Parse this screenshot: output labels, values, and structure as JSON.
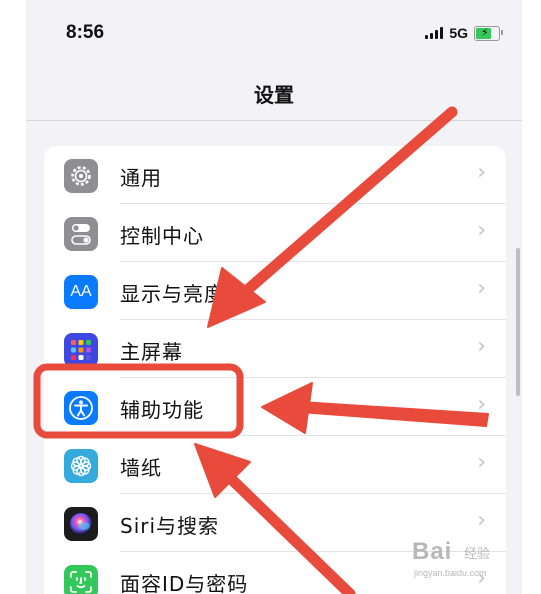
{
  "status_bar": {
    "time": "8:56",
    "network": "5G"
  },
  "nav": {
    "title": "设置"
  },
  "settings_items": [
    {
      "label": "通用",
      "icon": "gear-icon",
      "color": "#8e8e93"
    },
    {
      "label": "控制中心",
      "icon": "toggle-switches-icon",
      "color": "#8e8e93"
    },
    {
      "label": "显示与亮度",
      "icon": "text-size-aa-icon",
      "color": "#0a7aff"
    },
    {
      "label": "主屏幕",
      "icon": "app-grid-icon",
      "color": "#3c48e0"
    },
    {
      "label": "辅助功能",
      "icon": "accessibility-person-icon",
      "color": "#0a7aff"
    },
    {
      "label": "墙纸",
      "icon": "flower-icon",
      "color": "#35aadc"
    },
    {
      "label": "Siri与搜索",
      "icon": "siri-orb-icon",
      "color": "#1c1c1e"
    },
    {
      "label": "面容ID与密码",
      "icon": "face-id-icon",
      "color": "#34c759"
    }
  ],
  "aa_glyph": "AA",
  "chevron": "›",
  "highlight_color": "#e84a3c",
  "watermark": {
    "main": "Bai",
    "sub": "经验",
    "url": "jingyan.baidu.com"
  }
}
